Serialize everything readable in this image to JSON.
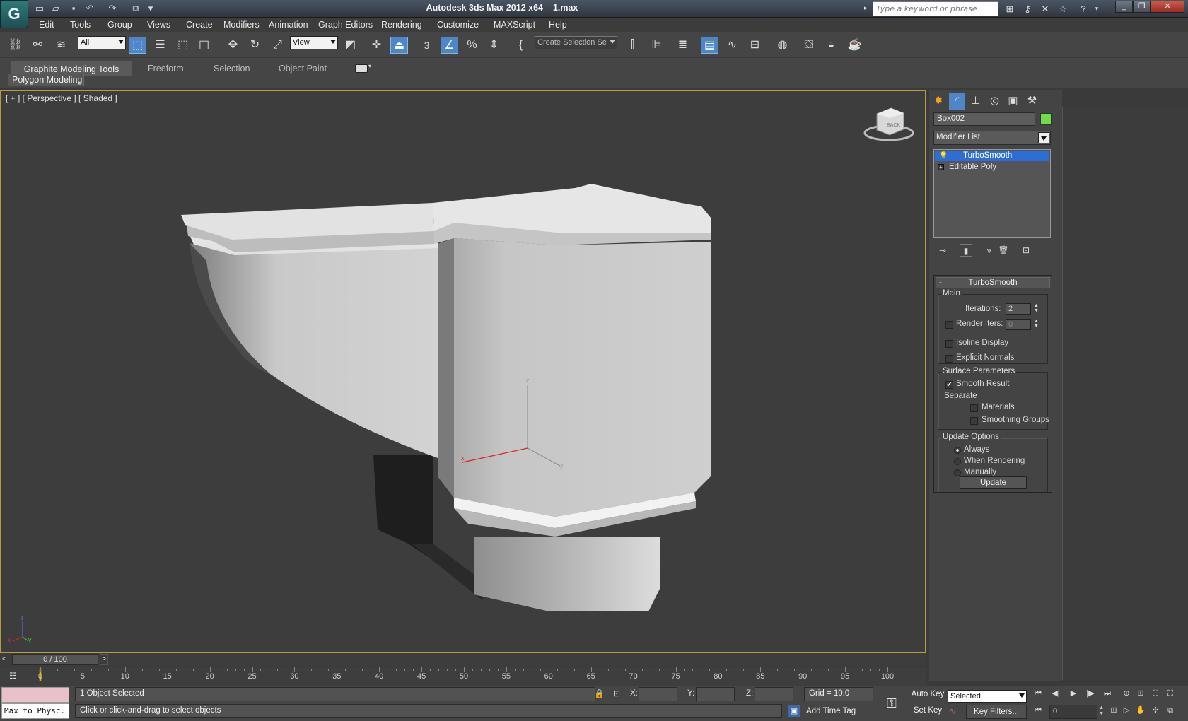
{
  "title": {
    "app": "Autodesk 3ds Max  2012 x64",
    "file": "1.max"
  },
  "app_logo": "3ds-max-logo-icon",
  "search": {
    "placeholder": "Type a keyword or phrase"
  },
  "menu": [
    "Edit",
    "Tools",
    "Group",
    "Views",
    "Create",
    "Modifiers",
    "Animation",
    "Graph Editors",
    "Rendering",
    "Customize",
    "MAXScript",
    "Help"
  ],
  "toolbar": {
    "filter_value": "All",
    "ref_coord_value": "View",
    "snap_label": "3",
    "selection_set_value": "Create Selection Se"
  },
  "ribbon": {
    "tabs": [
      "Graphite Modeling Tools",
      "Freeform",
      "Selection",
      "Object Paint"
    ],
    "sub_panel": "Polygon Modeling"
  },
  "viewport": {
    "label": "[ + ] [ Perspective ] [ Shaded ]",
    "viewcube_face": "BACK",
    "axis_labels": {
      "x": "x",
      "y": "y",
      "z": "z"
    }
  },
  "command_panel": {
    "object_name": "Box002",
    "object_color": "#6fdc4a",
    "modifier_list": "Modifier List",
    "stack": [
      "TurboSmooth",
      "Editable Poly"
    ],
    "rollout": {
      "title": "TurboSmooth",
      "main_group": "Main",
      "iterations_label": "Iterations:",
      "iterations_value": "2",
      "render_iters_label": "Render Iters:",
      "render_iters_value": "0",
      "isoline_label": "Isoline Display",
      "explicit_normals_label": "Explicit Normals",
      "surface_group": "Surface Parameters",
      "smooth_result_label": "Smooth Result",
      "smooth_result_checked": true,
      "separate_label": "Separate",
      "materials_label": "Materials",
      "smoothing_groups_label": "Smoothing Groups",
      "update_group": "Update Options",
      "always_label": "Always",
      "when_rendering_label": "When Rendering",
      "manually_label": "Manually",
      "selected_update_option": "Always",
      "update_button": "Update"
    }
  },
  "time_slider": {
    "label": "0 / 100",
    "current_frame": 0,
    "total_frames": 100
  },
  "trackbar_ticks": [
    "0",
    "5",
    "10",
    "15",
    "20",
    "25",
    "30",
    "35",
    "40",
    "45",
    "50",
    "55",
    "60",
    "65",
    "70",
    "75",
    "80",
    "85",
    "90",
    "95",
    "100"
  ],
  "status": {
    "maxscript_text": "Max to Physc.",
    "selected_text": "1 Object Selected",
    "prompt_text": "Click or click-and-drag to select objects",
    "x_label": "X:",
    "y_label": "Y:",
    "z_label": "Z:",
    "grid_text": "Grid = 10.0",
    "add_time_tag": "Add Time Tag",
    "auto_key": "Auto Key",
    "set_key": "Set Key",
    "key_mode_value": "Selected",
    "key_filters": "Key Filters...",
    "frame_value": "0"
  }
}
